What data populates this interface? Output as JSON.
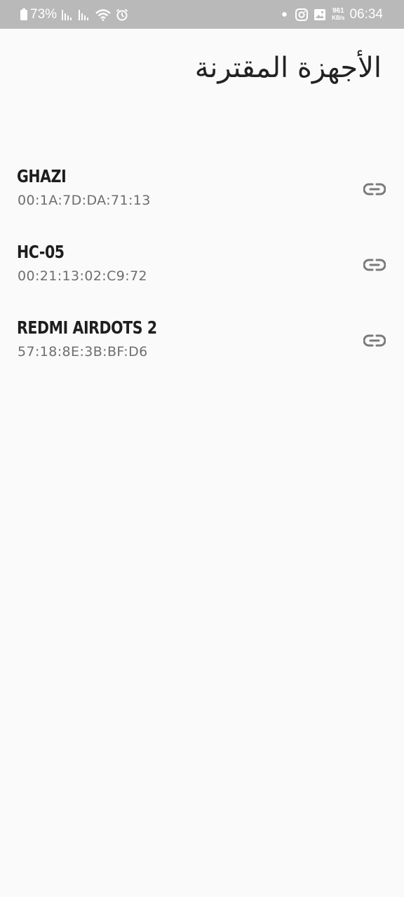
{
  "status_bar": {
    "battery": "73%",
    "net_speed_value": "961",
    "net_speed_unit": "KB/s",
    "time": "06:34",
    "icons": [
      "battery-icon",
      "signal-icon",
      "signal-icon",
      "wifi-icon",
      "alarm-icon",
      "dot-icon",
      "instagram-icon",
      "gallery-icon"
    ]
  },
  "header": {
    "title": "الأجهزة المقترنة"
  },
  "devices": [
    {
      "name": "GHAZI",
      "mac": "00:1A:7D:DA:71:13",
      "icon": "link-icon"
    },
    {
      "name": "HC-05",
      "mac": "00:21:13:02:C9:72",
      "icon": "link-icon"
    },
    {
      "name": "REDMI AIRDOTS 2",
      "mac": "57:18:8E:3B:BF:D6",
      "icon": "link-icon"
    }
  ],
  "colors": {
    "status_bar_bg": "#b9b9b9",
    "page_bg": "#fafafa",
    "name_text": "#1e1e1e",
    "mac_text": "#6e6e6e",
    "icon": "#7a7a7a"
  }
}
